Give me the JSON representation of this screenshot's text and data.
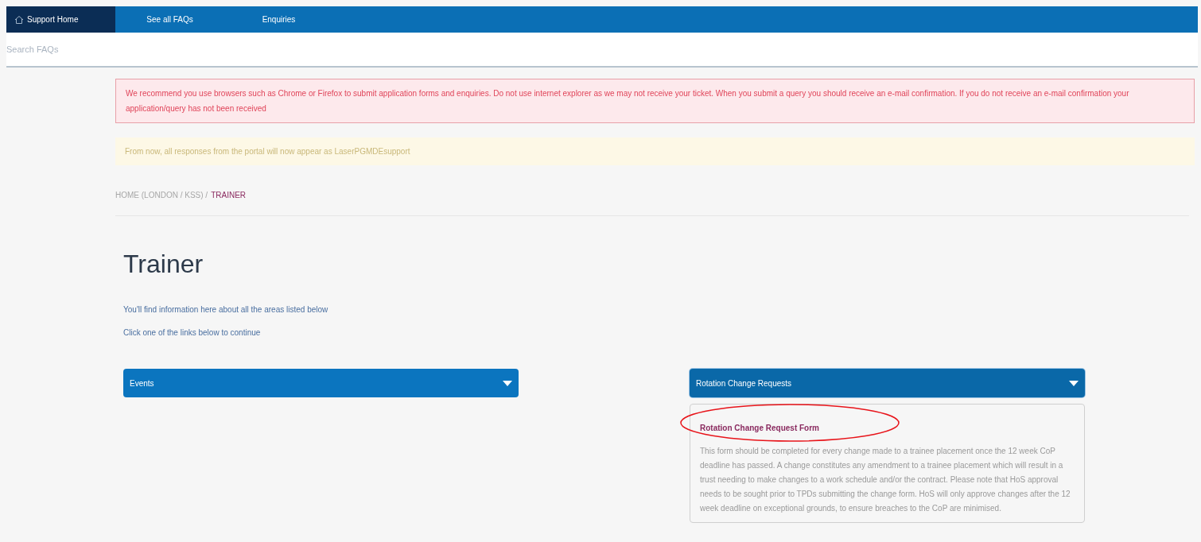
{
  "nav": {
    "items": [
      {
        "label": "Support Home",
        "selected": true
      },
      {
        "label": "See all FAQs",
        "selected": false
      },
      {
        "label": "Enquiries",
        "selected": false
      }
    ]
  },
  "search": {
    "placeholder": "Search FAQs"
  },
  "alerts": [
    {
      "kind": "danger",
      "text": "We recommend you use browsers such as Chrome or Firefox to submit application forms and enquiries. Do not use internet explorer as we may not receive your ticket. When you submit a query you should receive an e-mail confirmation. If you do not receive an e-mail confirmation your application/query has not been received"
    },
    {
      "kind": "warning",
      "text": "From now, all responses from the portal will now appear as LaserPGMDEsupport"
    }
  ],
  "breadcrumb": [
    {
      "label": "HOME (LONDON / KSS) /",
      "selected": false
    },
    {
      "label": "TRAINER",
      "selected": true
    }
  ],
  "title": "Trainer",
  "intro": [
    "You'll find information here about all the areas listed below",
    "Click one of the links below to continue"
  ],
  "sections": [
    {
      "title": "Events",
      "expanded": false
    },
    {
      "title": "Rotation Change Requests",
      "expanded": true,
      "links": [
        {
          "title": "Rotation Change Request Form",
          "highlighted": true,
          "text": "This form should be completed for every change made to a trainee placement once the 12 week CoP deadline has passed. A change constitutes any amendment to a trainee placement which will result in a trust needing to make changes to a work schedule and/or the contract. Please note that HoS approval needs to be sought prior to TPDs submitting the change form. HoS will only approve changes after the 12 week deadline on exceptional grounds, to ensure breaches to the CoP are minimised."
        }
      ]
    }
  ]
}
